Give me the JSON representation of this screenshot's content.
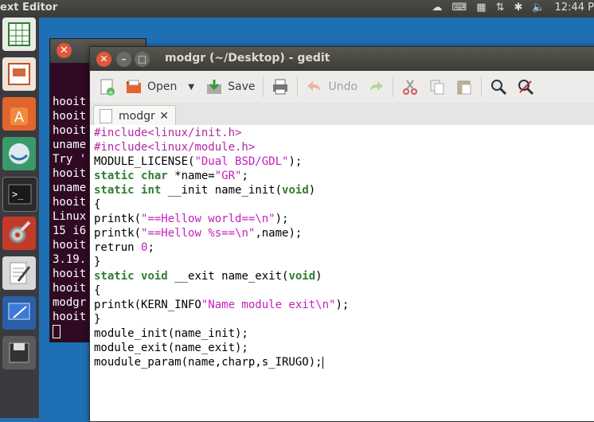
{
  "top_panel": {
    "app_title": "ext Editor",
    "clock": "12:44 P"
  },
  "terminal": {
    "lines": [
      "hooit",
      "hooit",
      "hooit",
      "uname",
      "Try '",
      "hooit",
      "uname",
      "hooit",
      "Linux",
      "15 i6",
      "hooit",
      "3.19.",
      "hooit",
      "hooit",
      "modgr",
      "hooit"
    ]
  },
  "gedit": {
    "title": "modgr (~/Desktop) - gedit",
    "toolbar": {
      "open_label": "Open",
      "save_label": "Save",
      "undo_label": "Undo"
    },
    "tab": {
      "label": "modgr"
    },
    "code_lines": [
      "#include<linux/init.h>",
      "#include<linux/module.h>",
      "MODULE_LICENSE(\"Dual BSD/GDL\");",
      "static char *name=\"GR\";",
      "static int __init name_init(void)",
      "{",
      "printk(\"==Hellow world==\\n\");",
      "printk(\"==Hellow %s==\\n\",name);",
      "retrun 0;",
      "}",
      "static void __exit name_exit(void)",
      "{",
      "printk(KERN_INFO\"Name module exit\\n\");",
      "}",
      "module_init(name_init);",
      "module_exit(name_exit);",
      "moudule_param(name,charp,s_IRUGO);"
    ]
  },
  "colors": {
    "preprocessor": "#b02aa3",
    "keyword": "#2e7d32",
    "string": "#c41fbd",
    "close_button": "#e0583a"
  }
}
